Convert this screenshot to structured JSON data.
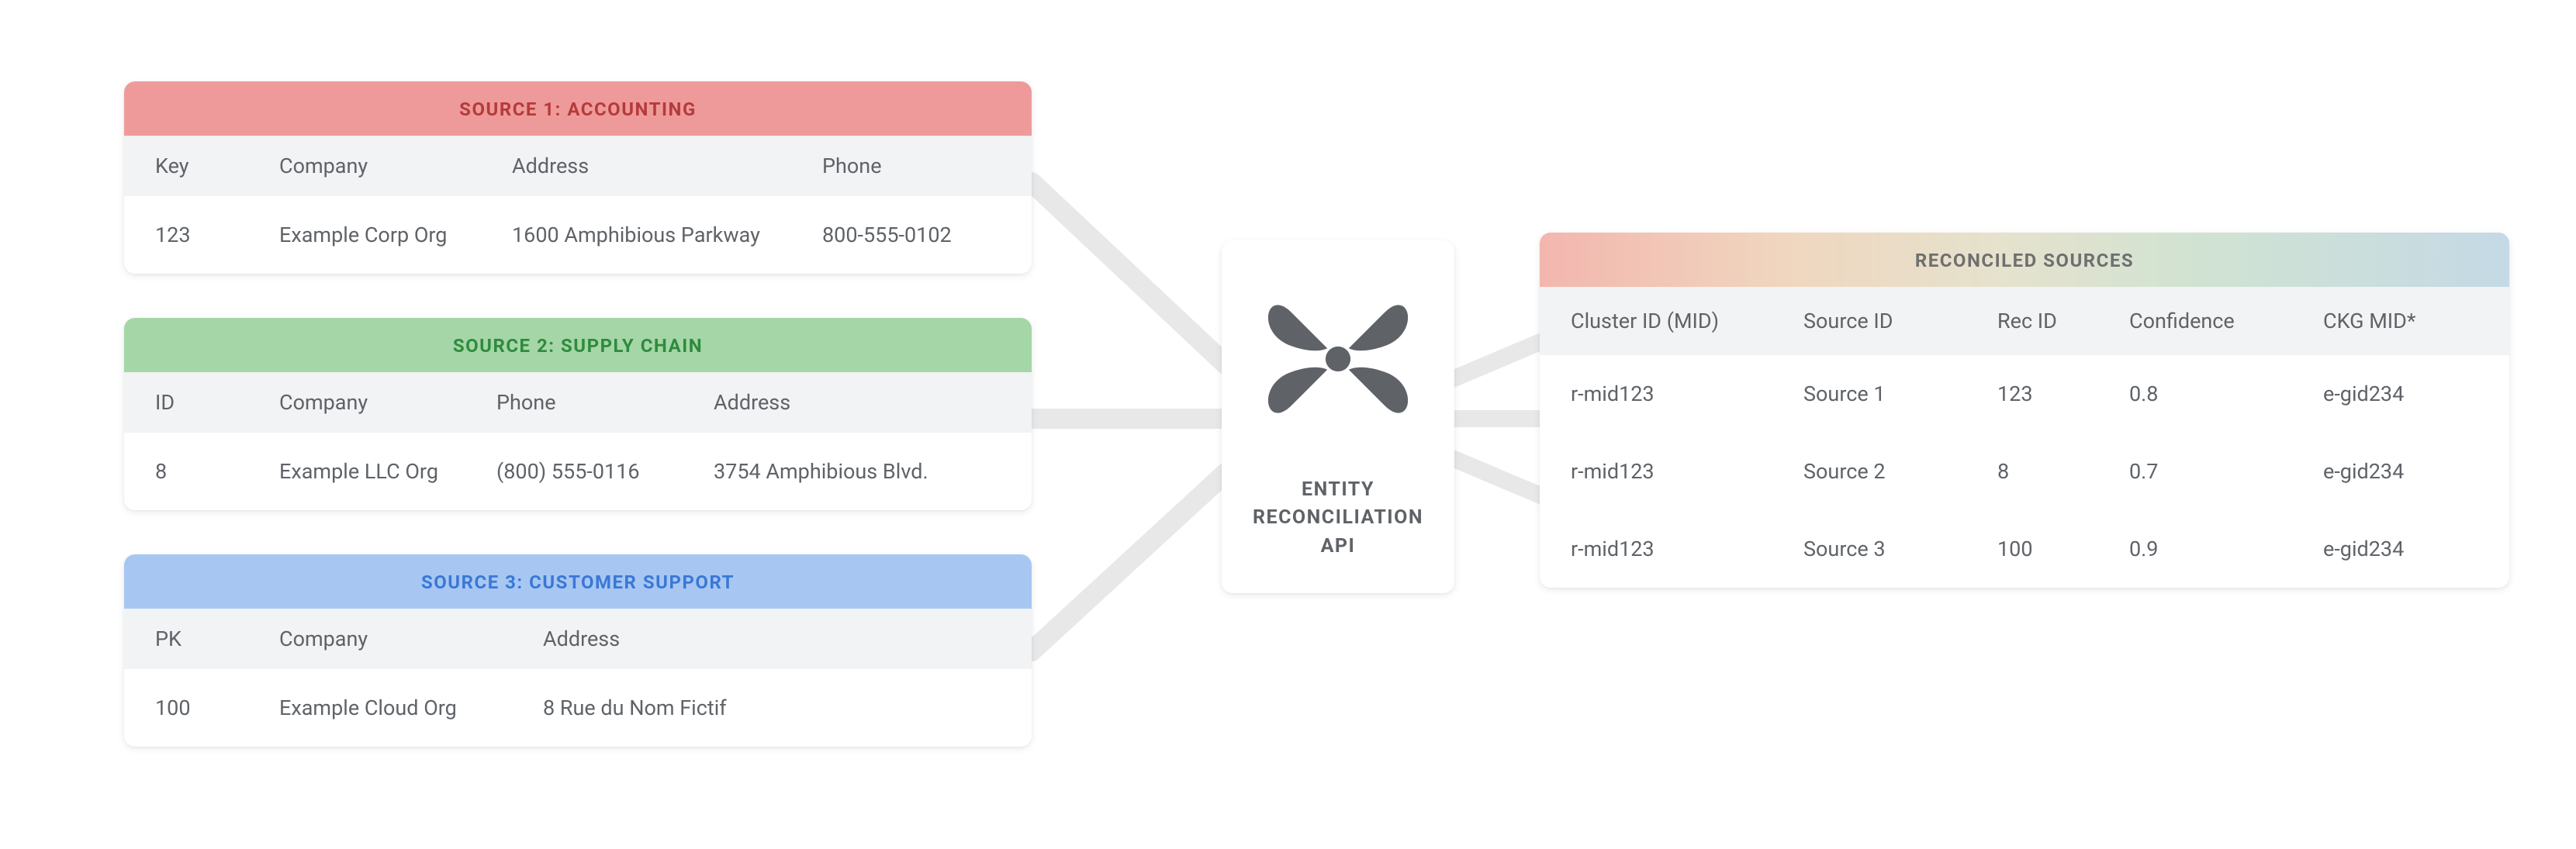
{
  "sources": [
    {
      "title": "SOURCE 1: ACCOUNTING",
      "headers": [
        "Key",
        "Company",
        "Address",
        "Phone"
      ],
      "row": [
        "123",
        "Example Corp Org",
        "1600 Amphibious Parkway",
        "800-555-0102"
      ]
    },
    {
      "title": "SOURCE 2: SUPPLY CHAIN",
      "headers": [
        "ID",
        "Company",
        "Phone",
        "Address"
      ],
      "row": [
        "8",
        "Example LLC Org",
        "(800) 555-0116",
        "3754 Amphibious Blvd."
      ]
    },
    {
      "title": "SOURCE 3: CUSTOMER SUPPORT",
      "headers": [
        "PK",
        "Company",
        "Address"
      ],
      "row": [
        "100",
        "Example Cloud Org",
        "8 Rue du Nom Fictif"
      ]
    }
  ],
  "api": {
    "line1": "ENTITY",
    "line2": "RECONCILIATION",
    "line3": "API"
  },
  "output": {
    "title": "RECONCILED SOURCES",
    "headers": [
      "Cluster ID (MID)",
      "Source ID",
      "Rec ID",
      "Confidence",
      "CKG MID*"
    ],
    "rows": [
      [
        "r-mid123",
        "Source 1",
        "123",
        "0.8",
        "e-gid234"
      ],
      [
        "r-mid123",
        "Source 2",
        "8",
        "0.7",
        "e-gid234"
      ],
      [
        "r-mid123",
        "Source 3",
        "100",
        "0.9",
        "e-gid234"
      ]
    ]
  }
}
